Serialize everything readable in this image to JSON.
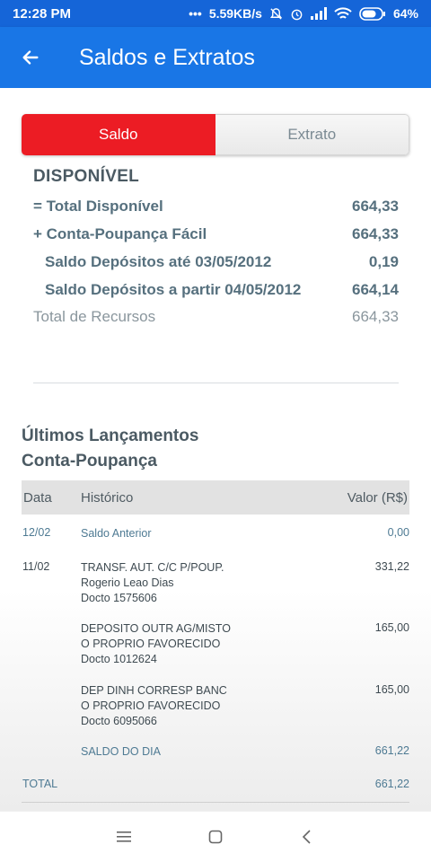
{
  "status_bar": {
    "time": "12:28 PM",
    "speed": "5.59KB/s",
    "battery": "64%"
  },
  "app_bar": {
    "title": "Saldos e Extratos"
  },
  "tabs": [
    {
      "label": "Saldo",
      "active": true
    },
    {
      "label": "Extrato",
      "active": false
    }
  ],
  "disponivel": {
    "heading": "DISPONÍVEL",
    "rows": [
      {
        "label": "= Total Disponível",
        "value": "664,33"
      },
      {
        "label": "+ Conta-Poupança Fácil",
        "value": "664,33"
      },
      {
        "label": "Saldo Depósitos até 03/05/2012",
        "value": "0,19"
      },
      {
        "label": "Saldo Depósitos a partir 04/05/2012",
        "value": "664,14"
      }
    ],
    "total_recursos": {
      "label": "Total de Recursos",
      "value": "664,33"
    }
  },
  "lancamentos": {
    "title_line1": "Últimos Lançamentos",
    "title_line2": "Conta-Poupança",
    "columns": [
      "Data",
      "Histórico",
      "Valor (R$)"
    ],
    "rows": [
      {
        "date": "12/02",
        "history": [
          "Saldo Anterior"
        ],
        "value": "0,00"
      },
      {
        "date": "11/02",
        "history": [
          "TRANSF. AUT. C/C P/POUP.",
          "Rogerio Leao Dias",
          "Docto 1575606"
        ],
        "value": "331,22"
      },
      {
        "date": "",
        "history": [
          "DEPOSITO OUTR AG/MISTO",
          "O PROPRIO FAVORECIDO",
          "Docto 1012624"
        ],
        "value": "165,00"
      },
      {
        "date": "",
        "history": [
          "DEP DINH CORRESP BANC",
          "O PROPRIO FAVORECIDO",
          "Docto 6095066"
        ],
        "value": "165,00"
      },
      {
        "date": "",
        "history": [
          "SALDO DO DIA"
        ],
        "value": "661,22"
      }
    ],
    "total": {
      "label": "TOTAL",
      "value": "661,22"
    }
  },
  "icons": {
    "back": "arrow-left-icon",
    "nav": [
      "menu-icon",
      "home-square-icon",
      "back-chevron-icon"
    ]
  },
  "colors": {
    "primary": "#1976e6",
    "accent_red": "#ec1c24"
  }
}
